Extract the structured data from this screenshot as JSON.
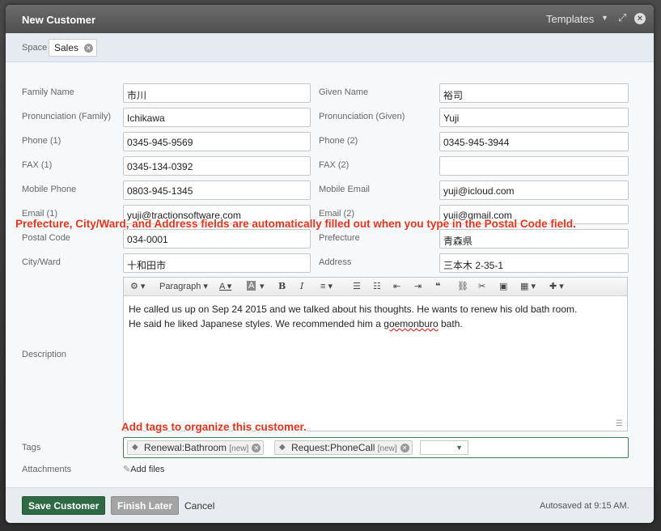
{
  "dialog": {
    "title": "New Customer",
    "templates_label": "Templates",
    "close_glyph": "×",
    "expand_glyph": "⤢"
  },
  "space": {
    "label": "Space",
    "value": "Sales"
  },
  "fields": {
    "family_name": {
      "label": "Family Name",
      "value": "市川"
    },
    "given_name": {
      "label": "Given Name",
      "value": "裕司"
    },
    "pron_family": {
      "label": "Pronunciation (Family)",
      "value": "Ichikawa"
    },
    "pron_given": {
      "label": "Pronunciation (Given)",
      "value": "Yuji"
    },
    "phone1": {
      "label": "Phone (1)",
      "value": "0345-945-9569"
    },
    "phone2": {
      "label": "Phone (2)",
      "value": "0345-945-3944"
    },
    "fax1": {
      "label": "FAX (1)",
      "value": "0345-134-0392"
    },
    "fax2": {
      "label": "FAX (2)",
      "value": ""
    },
    "mobile_phone": {
      "label": "Mobile Phone",
      "value": "0803-945-1345"
    },
    "mobile_email": {
      "label": "Mobile Email",
      "value": "yuji@icloud.com"
    },
    "email1": {
      "label": "Email (1)",
      "value": "yuji@tractionsoftware.com"
    },
    "email2": {
      "label": "Email (2)",
      "value": "yuji@gmail.com"
    },
    "postal_code": {
      "label": "Postal Code",
      "value": "034-0001"
    },
    "prefecture": {
      "label": "Prefecture",
      "value": "青森県"
    },
    "city_ward": {
      "label": "City/Ward",
      "value": "十和田市"
    },
    "address": {
      "label": "Address",
      "value": "三本木 2-35-1"
    }
  },
  "callouts": {
    "postal": "Prefecture, City/Ward, and Address fields are automatically filled out when you type in the Postal Code field.",
    "tags": "Add tags to organize this customer."
  },
  "description": {
    "label": "Description",
    "paragraph_label": "Paragraph",
    "line1": "He called us up on Sep 24 2015 and we talked about his thoughts. He wants to renew his old bath room.",
    "line2_pre": "He said he liked Japanese styles. We recommended him a ",
    "line2_misspelled": "goemonburo",
    "line2_post": " bath."
  },
  "tags": {
    "label": "Tags",
    "items": [
      {
        "text": "Renewal:Bathroom",
        "badge": "[new]"
      },
      {
        "text": "Request:PhoneCall",
        "badge": "[new]"
      }
    ]
  },
  "attachments": {
    "label": "Attachments",
    "add_files": "Add files"
  },
  "footer": {
    "save": "Save Customer",
    "finish_later": "Finish Later",
    "cancel": "Cancel",
    "autosaved": "Autosaved at 9:15 AM."
  }
}
